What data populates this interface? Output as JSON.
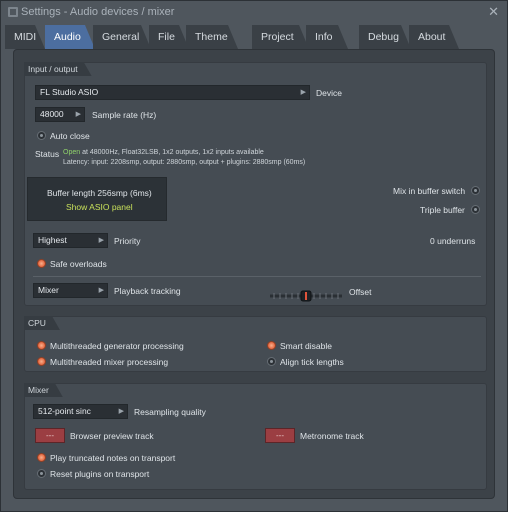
{
  "window": {
    "title": "Settings - Audio devices / mixer",
    "close_glyph": "✕"
  },
  "tabs": [
    {
      "label": "MIDI"
    },
    {
      "label": "Audio"
    },
    {
      "label": "General"
    },
    {
      "label": "File"
    },
    {
      "label": "Theme"
    },
    {
      "label": "Project"
    },
    {
      "label": "Info"
    },
    {
      "label": "Debug"
    },
    {
      "label": "About"
    }
  ],
  "active_tab": "Audio",
  "input_output": {
    "header": "Input / output",
    "device_value": "FL Studio ASIO",
    "device_label": "Device",
    "sample_rate_value": "48000",
    "sample_rate_label": "Sample rate (Hz)",
    "auto_close_label": "Auto close",
    "status_label": "Status",
    "status_open": "Open",
    "status_line1_rest": " at 48000Hz, Float32LSB, 1x2 outputs, 1x2 inputs available",
    "status_line2": "Latency: input: 2208smp, output: 2880smp, output + plugins: 2880smp (60ms)",
    "buffer_length": "Buffer length 256smp (6ms)",
    "show_asio_panel": "Show ASIO panel",
    "mix_in_buffer_switch": "Mix in buffer switch",
    "triple_buffer": "Triple buffer",
    "priority_value": "Highest",
    "priority_label": "Priority",
    "underruns": "0 underruns",
    "safe_overloads": "Safe overloads",
    "playback_tracking_value": "Mixer",
    "playback_tracking_label": "Playback tracking",
    "offset_label": "Offset"
  },
  "cpu": {
    "header": "CPU",
    "multithreaded_generator": "Multithreaded generator processing",
    "multithreaded_mixer": "Multithreaded mixer processing",
    "smart_disable": "Smart disable",
    "align_tick_lengths": "Align tick lengths"
  },
  "mixer": {
    "header": "Mixer",
    "resampling_value": "512-point sinc",
    "resampling_label": "Resampling quality",
    "browser_preview_btn": "---",
    "browser_preview_label": "Browser preview track",
    "metronome_btn": "---",
    "metronome_label": "Metronome track",
    "play_truncated": "Play truncated notes on transport",
    "reset_plugins": "Reset plugins on transport"
  },
  "colors": {
    "accent_tab": "#4c6ea0",
    "status_open": "#8fd16a",
    "asio_link": "#c8e05a",
    "radio_on": "#e8734c",
    "track_button": "#9b3e42"
  },
  "icons": {
    "title": "fl-studio-logo-icon",
    "dropdown": "triangle-right-icon",
    "close": "close-icon"
  }
}
